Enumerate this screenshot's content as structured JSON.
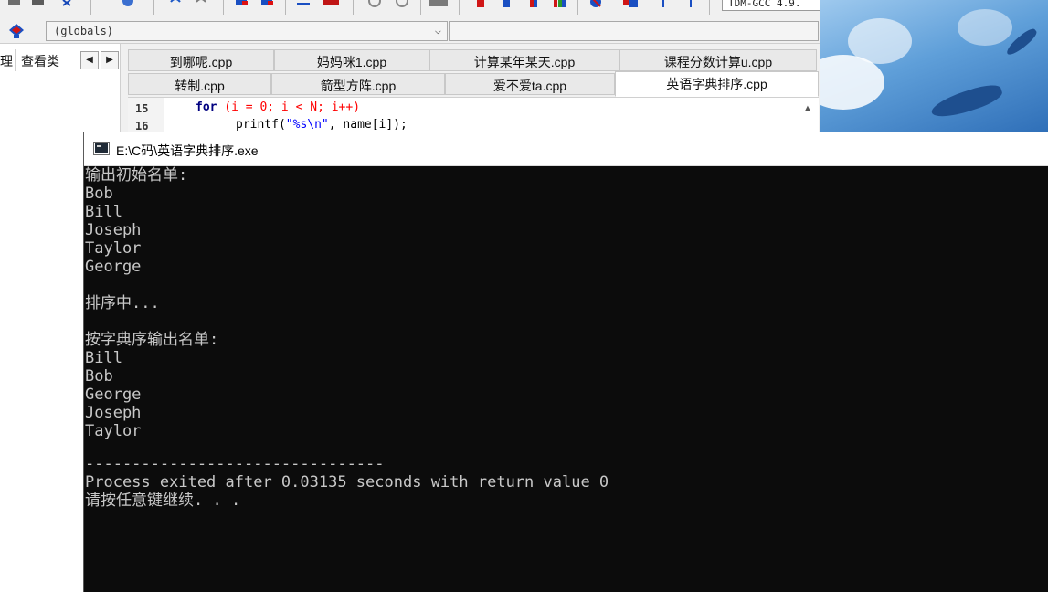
{
  "ide": {
    "compiler_label": "TDM-GCC 4.9.",
    "scope_select": "(globals)",
    "left_tabs": [
      "理",
      "查看类"
    ],
    "file_tabs_row1": [
      "到哪呢.cpp",
      "妈妈咪1.cpp",
      "计算某年某天.cpp",
      "课程分数计算u.cpp"
    ],
    "file_tabs_row2": [
      "转制.cpp",
      "箭型方阵.cpp",
      "爱不爱ta.cpp",
      "英语字典排序.cpp"
    ],
    "active_tab": "英语字典排序.cpp",
    "editor": {
      "line_numbers": [
        "15",
        "16"
      ],
      "line15": {
        "kw": "for",
        "open": " (i = ",
        "zero": "0",
        "mid": "; i < N; i++)"
      },
      "line16": {
        "fn": "printf(",
        "str": "\"%s\\n\"",
        "rest": ", name[i]);"
      }
    }
  },
  "console": {
    "title": "E:\\C码\\英语字典排序.exe",
    "lines": [
      "输出初始名单:",
      "Bob",
      "Bill",
      "Joseph",
      "Taylor",
      "George",
      "",
      "排序中...",
      "",
      "按字典序输出名单:",
      "Bill",
      "Bob",
      "George",
      "Joseph",
      "Taylor",
      "",
      "--------------------------------",
      "Process exited after 0.03135 seconds with return value 0",
      "请按任意键继续. . ."
    ]
  },
  "colors": {
    "console_bg": "#0c0c0c",
    "console_text": "#c8c8c8",
    "keyword": "#000080",
    "number": "#ff0000",
    "string": "#0000ff"
  }
}
